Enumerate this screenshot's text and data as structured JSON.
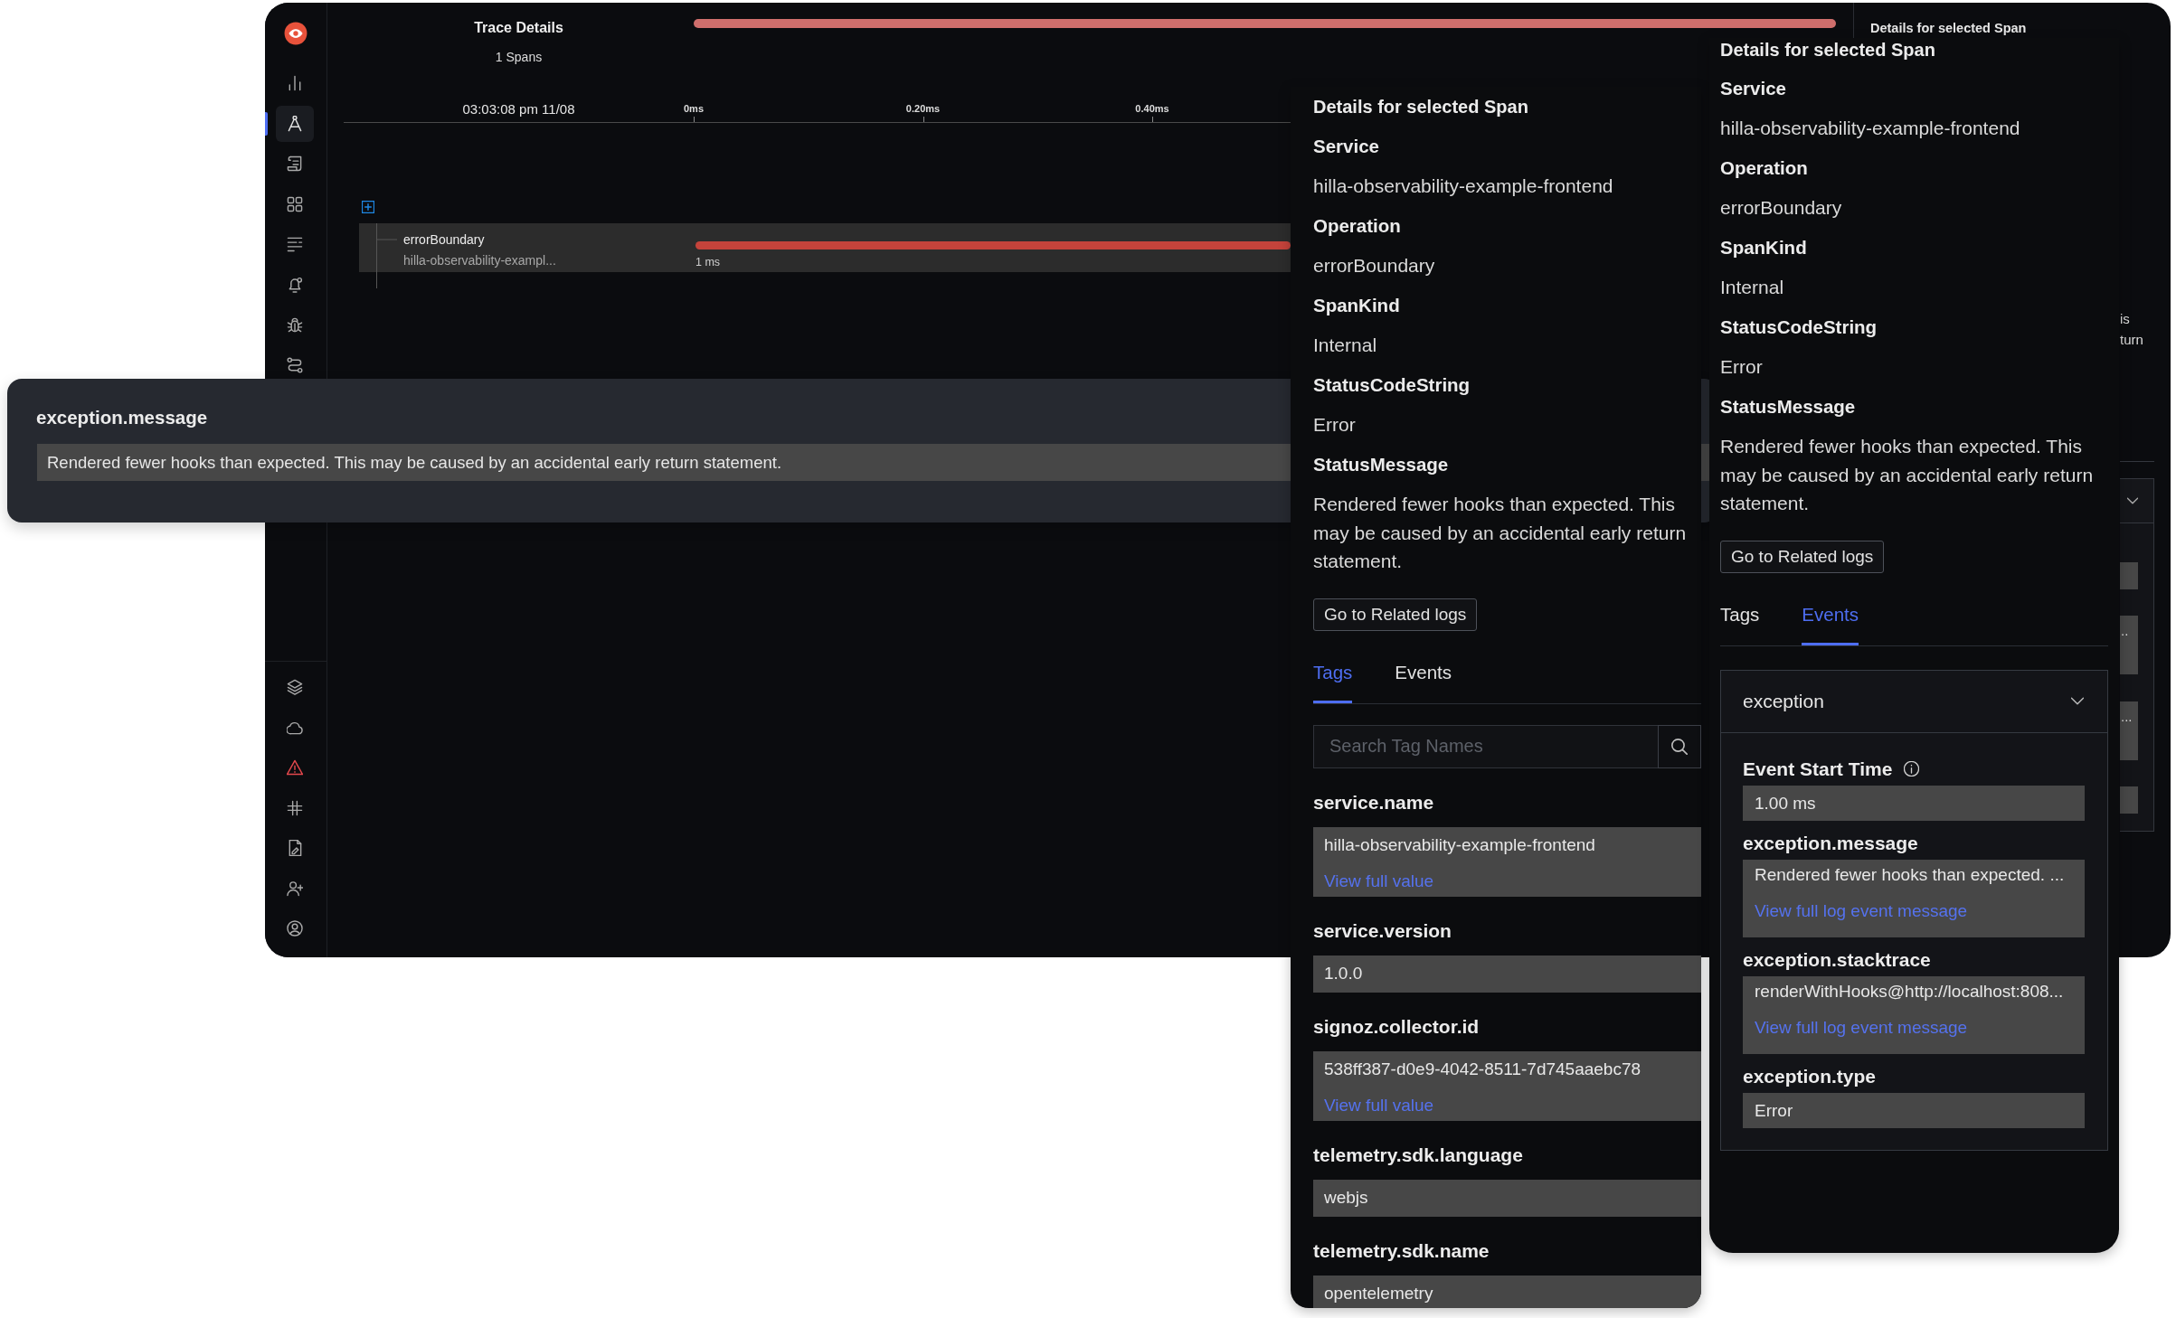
{
  "main_window": {
    "sidebar": {
      "top_items": [
        {
          "selected": false
        },
        {
          "selected": true
        },
        {
          "selected": false
        },
        {
          "selected": false
        },
        {
          "selected": false
        },
        {
          "selected": false
        },
        {
          "selected": false
        },
        {
          "selected": false
        }
      ],
      "bottom_items": [
        {
          "selected": false
        },
        {
          "selected": false
        },
        {
          "selected": false
        },
        {
          "selected": false
        },
        {
          "selected": false
        },
        {
          "selected": false
        },
        {
          "selected": false
        }
      ]
    },
    "trace": {
      "title": "Trace Details",
      "span_count": "1 Spans",
      "start_time": "03:03:08 pm 11/08",
      "ticks": [
        "0ms",
        "0.20ms",
        "0.40ms"
      ],
      "spans": [
        {
          "name": "errorBoundary",
          "service": "hilla-observability-exampl...",
          "duration": "1 ms",
          "selected": true
        }
      ]
    },
    "details": {
      "title": "Details for selected Span",
      "partial_lines": [
        "is",
        "turn"
      ],
      "partial_values": [
        "..",
        "..."
      ]
    }
  },
  "exception_popup": {
    "title": "exception.message",
    "value": "Rendered fewer hooks than expected. This may be caused by an accidental early return statement."
  },
  "tags_panel": {
    "title": "Details for selected Span",
    "fields": [
      {
        "label": "Service",
        "value": "hilla-observability-example-frontend"
      },
      {
        "label": "Operation",
        "value": "errorBoundary"
      },
      {
        "label": "SpanKind",
        "value": "Internal"
      },
      {
        "label": "StatusCodeString",
        "value": "Error"
      },
      {
        "label": "StatusMessage",
        "value": "Rendered fewer hooks than expected. This may be caused by an accidental early return statement."
      }
    ],
    "related_logs_button": "Go to Related logs",
    "tabs": [
      {
        "label": "Tags",
        "selected": true
      },
      {
        "label": "Events",
        "selected": false
      }
    ],
    "search": {
      "placeholder": "Search Tag Names"
    },
    "tags": [
      {
        "key": "service.name",
        "value": "hilla-observability-example-frontend",
        "link": "View full value"
      },
      {
        "key": "service.version",
        "value": "1.0.0"
      },
      {
        "key": "signoz.collector.id",
        "value": "538ff387-d0e9-4042-8511-7d745aaebc78",
        "link": "View full value"
      },
      {
        "key": "telemetry.sdk.language",
        "value": "webjs"
      },
      {
        "key": "telemetry.sdk.name",
        "value": "opentelemetry"
      }
    ]
  },
  "events_panel": {
    "title": "Details for selected Span",
    "fields": [
      {
        "label": "Service",
        "value": "hilla-observability-example-frontend"
      },
      {
        "label": "Operation",
        "value": "errorBoundary"
      },
      {
        "label": "SpanKind",
        "value": "Internal"
      },
      {
        "label": "StatusCodeString",
        "value": "Error"
      },
      {
        "label": "StatusMessage",
        "value": "Rendered fewer hooks than expected. This may be caused by an accidental early return statement."
      }
    ],
    "related_logs_button": "Go to Related logs",
    "tabs": [
      {
        "label": "Tags",
        "selected": false
      },
      {
        "label": "Events",
        "selected": true
      }
    ],
    "events": [
      {
        "name": "exception",
        "expanded": true,
        "attributes": [
          {
            "key": "Event Start Time",
            "value": "1.00 ms",
            "info": true
          },
          {
            "key": "exception.message",
            "value": "Rendered fewer hooks than expected. ...",
            "link": "View full log event message"
          },
          {
            "key": "exception.stacktrace",
            "value": "renderWithHooks@http://localhost:808...",
            "link": "View full log event message"
          },
          {
            "key": "exception.type",
            "value": "Error"
          }
        ]
      }
    ]
  }
}
